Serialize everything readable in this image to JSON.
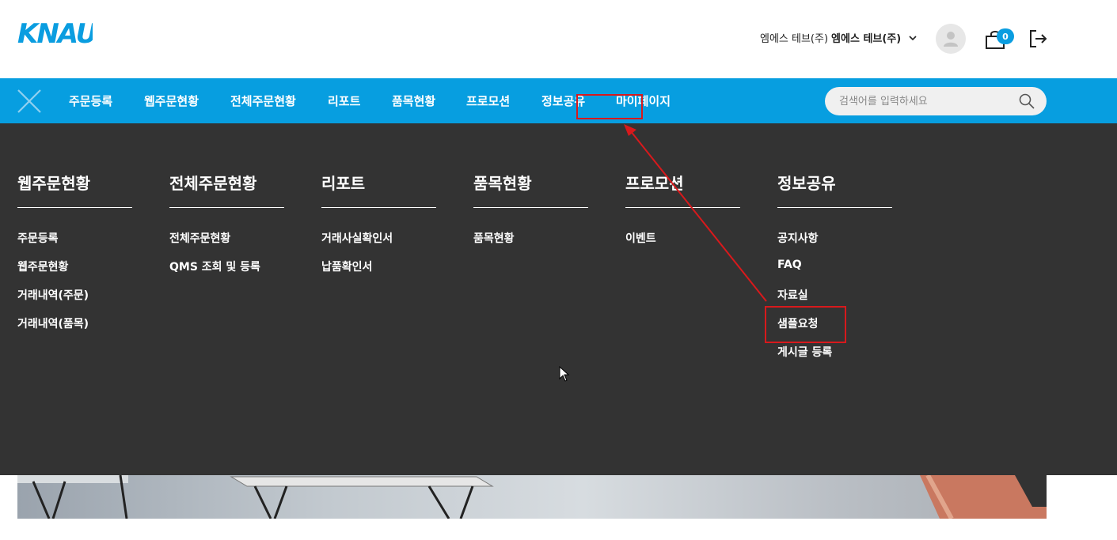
{
  "brand": {
    "logo_text": "KNAUF",
    "color": "#0a9de0"
  },
  "header": {
    "company_regular": "엠에스 테브(주)",
    "company_bold": "엠에스 테브(주)",
    "cart_count": "0",
    "icons": [
      "chevron-down-icon",
      "user-icon",
      "shopping-bag-icon",
      "logout-icon"
    ]
  },
  "nav": {
    "items": [
      {
        "label": "주문등록"
      },
      {
        "label": "웹주문현황"
      },
      {
        "label": "전체주문현황"
      },
      {
        "label": "리포트"
      },
      {
        "label": "품목현황"
      },
      {
        "label": "프로모션"
      },
      {
        "label": "정보공유"
      },
      {
        "label": "마이페이지"
      }
    ],
    "search_placeholder": "검색어를 입력하세요",
    "bar_color": "#079ee0"
  },
  "mega_menu": {
    "bg_color": "#333333",
    "columns": [
      {
        "title": "웹주문현황",
        "links": [
          "주문등록",
          "웹주문현황",
          "거래내역(주문)",
          "거래내역(품목)"
        ]
      },
      {
        "title": "전체주문현황",
        "links": [
          "전체주문현황",
          "QMS 조회 및 등록"
        ]
      },
      {
        "title": "리포트",
        "links": [
          "거래사실확인서",
          "납품확인서"
        ]
      },
      {
        "title": "품목현황",
        "links": [
          "품목현황"
        ]
      },
      {
        "title": "프로모션",
        "links": [
          "이벤트"
        ]
      },
      {
        "title": "정보공유",
        "links": [
          "공지사항",
          "FAQ",
          "자료실",
          "샘플요청",
          "게시글 등록"
        ]
      }
    ]
  },
  "annotation": {
    "color": "#d8191c"
  }
}
